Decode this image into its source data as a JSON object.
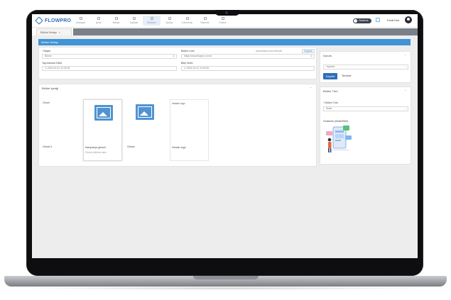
{
  "app": {
    "logo_text": "FLOWPRO"
  },
  "nav": {
    "items": [
      {
        "label": "Anasayfa",
        "icon": "home-icon"
      },
      {
        "label": "Içerik",
        "icon": "content-icon"
      },
      {
        "label": "Medya",
        "icon": "media-icon"
      },
      {
        "label": "Sayfalar",
        "icon": "pages-icon"
      },
      {
        "label": "Bölümler",
        "icon": "sections-icon",
        "active": true
      },
      {
        "label": "Ayarlar",
        "icon": "settings-icon"
      },
      {
        "label": "Kullanıcılar",
        "icon": "users-icon"
      },
      {
        "label": "Raporlar",
        "icon": "reports-icon"
      },
      {
        "label": "Destek",
        "icon": "support-icon"
      }
    ]
  },
  "topright": {
    "toggle_label": "Önizleme",
    "user_name": "Ferdi Ken"
  },
  "tabs": [
    {
      "label": "Bölüm Detayı",
      "close": "×"
    }
  ],
  "header": {
    "title": "Bölüm Detayı"
  },
  "form": {
    "title_label": "Başlık",
    "title_value": "Bölüm",
    "status_label": "Bölüm Linki",
    "status_value": "https://www.flowpro.com.tr",
    "url_text": "www.flowpro.com.tr/bolum",
    "copy_label": "Kopyala",
    "publish_date_label": "Yayınlanma Tarihi",
    "publish_date_value": "2024-01-01 12:00:00",
    "end_date_label": "Bitiş Tarihi",
    "end_date_value": "2024-01-01 12:00:00"
  },
  "content": {
    "section_title": "Bölüm İçeriği",
    "collapse_glyph": "^",
    "items": [
      {
        "broken_alt": "Görsel",
        "caption": "Görsel 1",
        "placeholder": false
      },
      {
        "placeholder": true,
        "caption": "Kampanya görseli",
        "subcaption": "Görsel yükleme alanı"
      },
      {
        "placeholder": true,
        "caption": "Görsel"
      },
      {
        "broken_alt": "Header logo",
        "caption": "Header logo",
        "placeholder": false
      }
    ]
  },
  "status_panel": {
    "title": "Durum",
    "select_value": "Yayında",
    "save_label": "Kaydet",
    "clear_label": "Temizle"
  },
  "section_panel": {
    "title": "Bölüm Türü",
    "type_label": "Bölüm Türü",
    "type_value": "Slider",
    "preview_label": "Önizleme (Mobil/Web)"
  },
  "colors": {
    "accent": "#3f93d6",
    "primary": "#2f6fb8"
  }
}
